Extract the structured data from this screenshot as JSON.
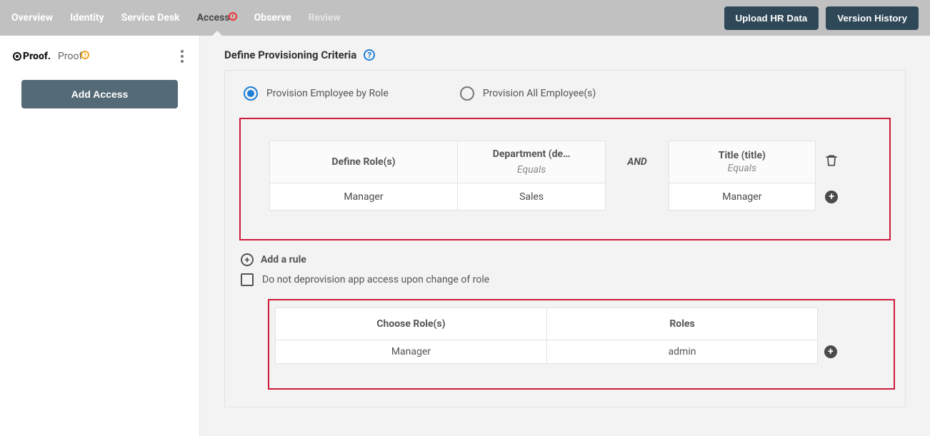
{
  "topbar": {
    "tabs": [
      "Overview",
      "Identity",
      "Service Desk",
      "Access",
      "Observe",
      "Review"
    ],
    "actions": {
      "upload": "Upload HR Data",
      "version": "Version History"
    }
  },
  "sidebar": {
    "brand_text": "Proof.",
    "app_name": "Proof",
    "add_access": "Add Access"
  },
  "section": {
    "title": "Define Provisioning Criteria",
    "radio": {
      "by_role": "Provision Employee by Role",
      "all": "Provision All Employee(s)"
    },
    "rule_table": {
      "col_role": "Define Role(s)",
      "col_dept": "Department (de…",
      "equals": "Equals",
      "and": "AND",
      "col_title": "Title (title)",
      "row": {
        "role": "Manager",
        "dept": "Sales",
        "title": "Manager"
      }
    },
    "add_rule": "Add a rule",
    "checkbox_label": "Do not deprovision app access upon change of role",
    "roles_table": {
      "col_choose": "Choose Role(s)",
      "col_roles": "Roles",
      "row": {
        "choose": "Manager",
        "roles": "admin"
      }
    }
  }
}
